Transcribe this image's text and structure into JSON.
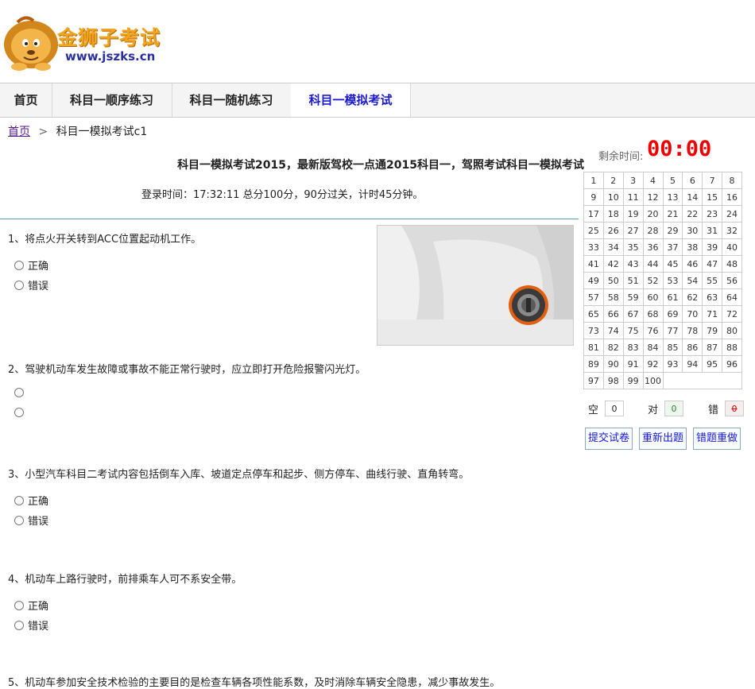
{
  "header": {
    "logo_cn": "金狮子考试",
    "logo_url": "www.jszks.cn"
  },
  "nav": [
    {
      "label": "首页"
    },
    {
      "label": "科目一顺序练习"
    },
    {
      "label": "科目一随机练习"
    },
    {
      "label": "科目一模拟考试",
      "active": true
    }
  ],
  "breadcrumb": {
    "home": "首页",
    "sep": ">",
    "current": "科目一模拟考试c1"
  },
  "exam": {
    "title": "科目一模拟考试2015，最新版驾校一点通2015科目一，驾照考试科目一模拟考试",
    "info": "登录时间：17:32:11 总分100分，90分过关，计时45分钟。"
  },
  "questions": [
    {
      "text": "1、将点火开关转到ACC位置起动机工作。",
      "options": [
        "正确",
        "错误"
      ]
    },
    {
      "text": "2、驾驶机动车发生故障或事故不能正常行驶时，应立即打开危险报警闪光灯。",
      "options": [
        "",
        ""
      ]
    },
    {
      "text": "3、小型汽车科目二考试内容包括倒车入库、坡道定点停车和起步、侧方停车、曲线行驶、直角转弯。",
      "options": [
        "正确",
        "错误"
      ]
    },
    {
      "text": "4、机动车上路行驶时，前排乘车人可不系安全带。",
      "options": [
        "正确",
        "错误"
      ]
    },
    {
      "text": "5、机动车参加安全技术检验的主要目的是检查车辆各项性能系数，及时消除车辆安全隐患，减少事故发生。",
      "options": []
    }
  ],
  "sidebar": {
    "timer_label": "剩余时间:",
    "timer": "00:00",
    "question_count": 100,
    "stats": {
      "empty_label": "空",
      "empty": "0",
      "correct_label": "对",
      "correct": "0",
      "wrong_label": "错",
      "wrong": "0"
    },
    "buttons": {
      "submit": "提交试卷",
      "regenerate": "重新出题",
      "redo_wrong": "错题重做"
    }
  },
  "colors": {
    "accent": "#1a1ad2",
    "timer": "#e00000",
    "correct": "#2a8a2a",
    "wrong": "#d00000",
    "divider": "#5aa3b5"
  }
}
